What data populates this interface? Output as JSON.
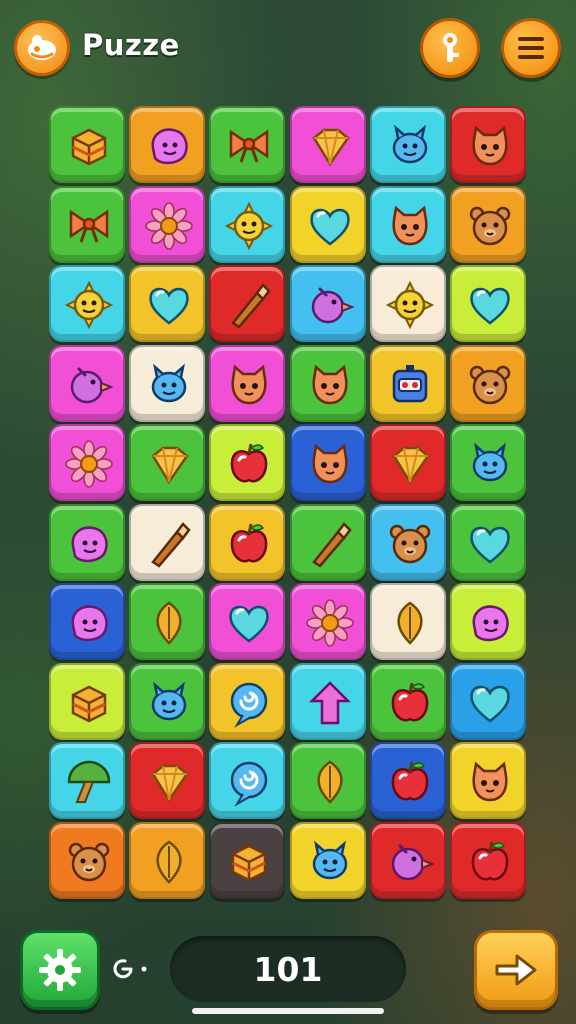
{
  "header": {
    "title": "Puzze",
    "logo_icon": "puzzle-logo-icon",
    "hint_button_icon": "key-icon",
    "menu_button_icon": "hamburger-menu-icon"
  },
  "board": {
    "columns": 6,
    "rows": 10,
    "tiles": [
      {
        "color": "#4cc33c",
        "icon": "box"
      },
      {
        "color": "#f2a021",
        "icon": "blob"
      },
      {
        "color": "#4cc33c",
        "icon": "bow"
      },
      {
        "color": "#f04fd6",
        "icon": "crystal"
      },
      {
        "color": "#44d6e8",
        "icon": "creature"
      },
      {
        "color": "#e02a2a",
        "icon": "cat"
      },
      {
        "color": "#4cc33c",
        "icon": "bow"
      },
      {
        "color": "#f04fd6",
        "icon": "flower"
      },
      {
        "color": "#44d6e8",
        "icon": "sun-face"
      },
      {
        "color": "#f2d32a",
        "icon": "heart"
      },
      {
        "color": "#44d6e8",
        "icon": "cat"
      },
      {
        "color": "#f2a021",
        "icon": "bear"
      },
      {
        "color": "#44d6e8",
        "icon": "sun-face"
      },
      {
        "color": "#f2c42a",
        "icon": "heart"
      },
      {
        "color": "#e02a2a",
        "icon": "brush"
      },
      {
        "color": "#44c0f0",
        "icon": "bird"
      },
      {
        "color": "#f6ecd8",
        "icon": "sun-face"
      },
      {
        "color": "#c8ee3a",
        "icon": "heart"
      },
      {
        "color": "#f04fd6",
        "icon": "bird"
      },
      {
        "color": "#f6ecd8",
        "icon": "creature"
      },
      {
        "color": "#f04fd6",
        "icon": "cat"
      },
      {
        "color": "#4cc33c",
        "icon": "cat"
      },
      {
        "color": "#f2c42a",
        "icon": "robot"
      },
      {
        "color": "#f2a021",
        "icon": "bear"
      },
      {
        "color": "#f04fd6",
        "icon": "flower"
      },
      {
        "color": "#4cc33c",
        "icon": "crystal"
      },
      {
        "color": "#c8ee3a",
        "icon": "apple"
      },
      {
        "color": "#2a62d6",
        "icon": "cat"
      },
      {
        "color": "#e02a2a",
        "icon": "crystal"
      },
      {
        "color": "#4cc33c",
        "icon": "creature"
      },
      {
        "color": "#4cc33c",
        "icon": "blob"
      },
      {
        "color": "#f6ecd8",
        "icon": "brush"
      },
      {
        "color": "#f2c42a",
        "icon": "apple"
      },
      {
        "color": "#4cc33c",
        "icon": "brush"
      },
      {
        "color": "#44c0f0",
        "icon": "bear"
      },
      {
        "color": "#4cc33c",
        "icon": "heart"
      },
      {
        "color": "#2a62d6",
        "icon": "blob"
      },
      {
        "color": "#4cc33c",
        "icon": "leaf"
      },
      {
        "color": "#f04fd6",
        "icon": "heart"
      },
      {
        "color": "#f04fd6",
        "icon": "flower"
      },
      {
        "color": "#f6ecd8",
        "icon": "leaf"
      },
      {
        "color": "#c8ee3a",
        "icon": "blob"
      },
      {
        "color": "#c8ee3a",
        "icon": "box"
      },
      {
        "color": "#4cc33c",
        "icon": "creature"
      },
      {
        "color": "#f2c42a",
        "icon": "swirl"
      },
      {
        "color": "#44d6e8",
        "icon": "arrow"
      },
      {
        "color": "#4cc33c",
        "icon": "apple"
      },
      {
        "color": "#2aa0e8",
        "icon": "heart"
      },
      {
        "color": "#44d6e8",
        "icon": "mushroom"
      },
      {
        "color": "#e02a2a",
        "icon": "crystal"
      },
      {
        "color": "#44d6e8",
        "icon": "swirl"
      },
      {
        "color": "#4cc33c",
        "icon": "leaf"
      },
      {
        "color": "#2a62d6",
        "icon": "apple"
      },
      {
        "color": "#f2d32a",
        "icon": "cat"
      },
      {
        "color": "#f07a20",
        "icon": "bear"
      },
      {
        "color": "#f2a021",
        "icon": "leaf"
      },
      {
        "color": "#4a4242",
        "icon": "box"
      },
      {
        "color": "#f2d32a",
        "icon": "creature"
      },
      {
        "color": "#e02a2a",
        "icon": "bird"
      },
      {
        "color": "#e02a2a",
        "icon": "apple"
      }
    ]
  },
  "footer": {
    "settings_icon": "gear-icon",
    "timer_icon": "timer-icon",
    "score": "101",
    "next_icon": "arrow-right-icon"
  }
}
